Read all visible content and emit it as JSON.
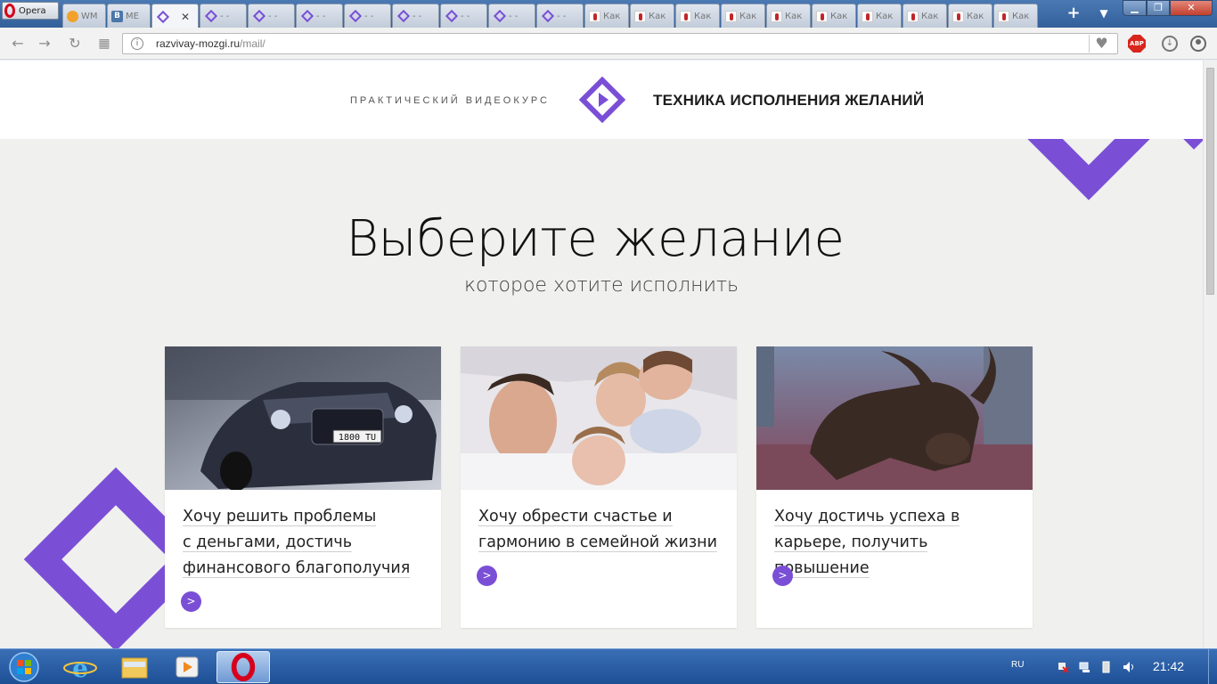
{
  "browser": {
    "menu_label": "Opera",
    "tabs": [
      {
        "label": "WM",
        "icon": "wm-icon",
        "active": false
      },
      {
        "label": "МЕ",
        "icon": "vk-icon",
        "active": false
      },
      {
        "label": "",
        "icon": "diamond-icon",
        "active": true
      },
      {
        "label": "- -",
        "icon": "diamond-icon",
        "active": false
      },
      {
        "label": "- -",
        "icon": "diamond-icon",
        "active": false
      },
      {
        "label": "- -",
        "icon": "diamond-icon",
        "active": false
      },
      {
        "label": "- -",
        "icon": "diamond-icon",
        "active": false
      },
      {
        "label": "- -",
        "icon": "diamond-icon",
        "active": false
      },
      {
        "label": "- -",
        "icon": "diamond-icon",
        "active": false
      },
      {
        "label": "- -",
        "icon": "diamond-icon",
        "active": false
      },
      {
        "label": "- -",
        "icon": "diamond-icon",
        "active": false
      },
      {
        "label": "Как",
        "icon": "man-icon",
        "active": false
      },
      {
        "label": "Как",
        "icon": "man-icon",
        "active": false
      },
      {
        "label": "Как",
        "icon": "man-icon",
        "active": false
      },
      {
        "label": "Как",
        "icon": "man-icon",
        "active": false
      },
      {
        "label": "Как",
        "icon": "man-icon",
        "active": false
      },
      {
        "label": "Как",
        "icon": "man-icon",
        "active": false
      },
      {
        "label": "Как",
        "icon": "man-icon",
        "active": false
      },
      {
        "label": "Как",
        "icon": "man-icon",
        "active": false
      },
      {
        "label": "Как",
        "icon": "man-icon",
        "active": false
      },
      {
        "label": "Как",
        "icon": "man-icon",
        "active": false
      }
    ],
    "url_host": "razvivay-mozgi.ru",
    "url_path": "/mail/",
    "adblock_label": "ABP"
  },
  "header": {
    "subtitle": "ПРАКТИЧЕСКИЙ ВИДЕОКУРС",
    "title": "ТЕХНИКА ИСПОЛНЕНИЯ ЖЕЛАНИЙ"
  },
  "hero": {
    "title": "Выберите желание",
    "subtitle": "которое хотите исполнить"
  },
  "cards": [
    {
      "lines": [
        "Хочу решить проблемы",
        "с деньгами, достичь",
        "финансового благополучия"
      ],
      "image": "luxury car",
      "plate": "1800 TU"
    },
    {
      "lines": [
        "Хочу обрести счастье и",
        "гармонию в семейной жизни"
      ],
      "image": "family in bed"
    },
    {
      "lines": [
        "Хочу достичь успеха в",
        "карьере, получить повышение"
      ],
      "image": "bronze bull statue"
    }
  ],
  "taskbar": {
    "language": "RU",
    "clock": "21:42"
  },
  "colors": {
    "accent": "#7a4fd6",
    "page_bg": "#f0f0ee",
    "taskbar": "#1d4f95"
  }
}
